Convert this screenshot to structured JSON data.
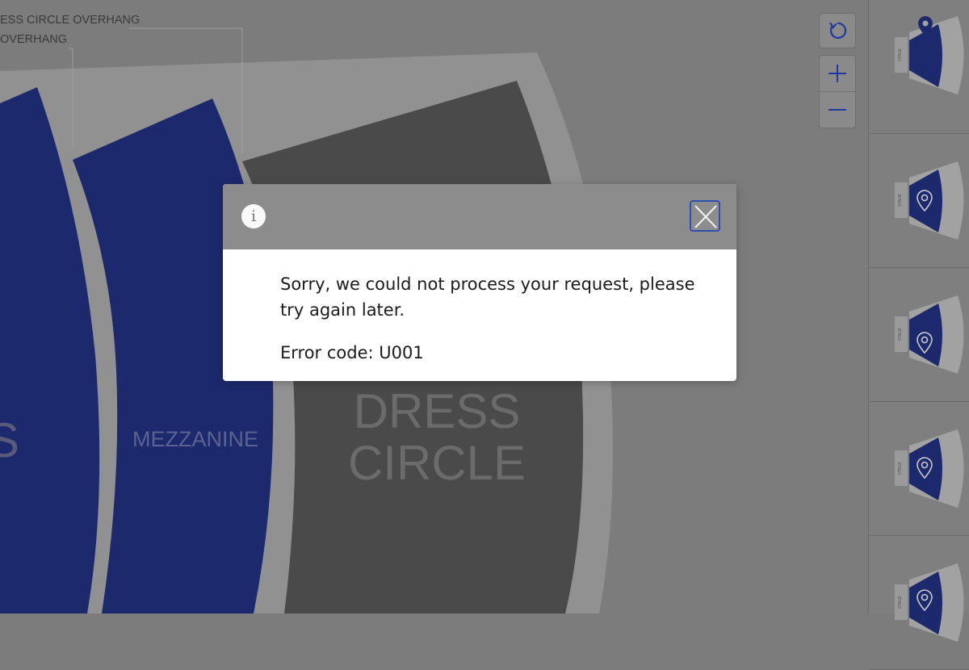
{
  "seat_map": {
    "labels": {
      "dress_circle_overhang": "ESS CIRCLE OVERHANG",
      "overhang": "OVERHANG",
      "orchestra_partial": "S",
      "mezzanine": "MEZZANINE",
      "dress_line1": "DRESS",
      "dress_line2": "CIRCLE"
    },
    "controls": {
      "reset_icon": "refresh-icon",
      "zoom_in_icon": "plus-icon",
      "zoom_out_icon": "minus-icon"
    },
    "colors": {
      "blue_section": "#1c2a6d",
      "dark_section": "#4a4a4a",
      "highlight_blue": "#11216a"
    }
  },
  "sidebar": {
    "thumbnails": [
      {
        "pin_icon": "location-pin-icon",
        "stage_label": "STAGE"
      },
      {
        "pin_icon": "location-pin-icon",
        "stage_label": "STAGE"
      },
      {
        "pin_icon": "location-pin-icon",
        "stage_label": "STAGE"
      },
      {
        "pin_icon": "location-pin-icon",
        "stage_label": "STAGE"
      },
      {
        "pin_icon": "location-pin-icon",
        "stage_label": "STAGE"
      }
    ]
  },
  "modal": {
    "info_icon": "i",
    "message": "Sorry, we could not process your request, please try again later.",
    "error_code": "Error code: U001"
  }
}
